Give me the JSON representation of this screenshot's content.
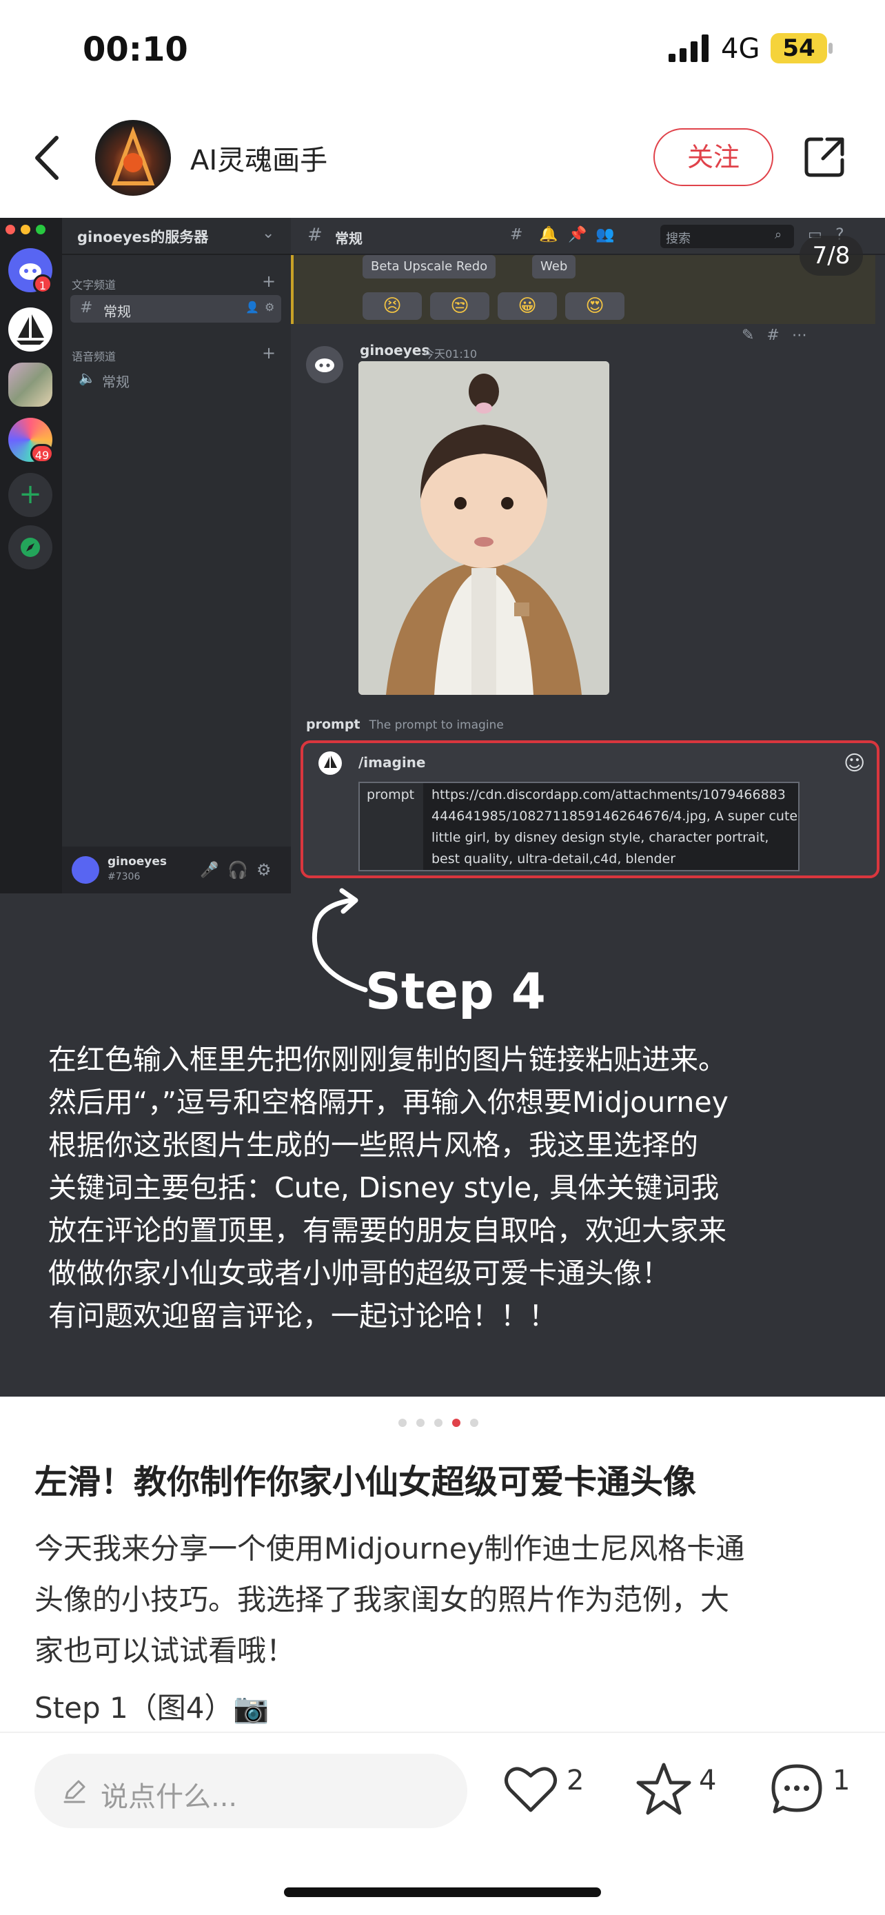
{
  "status_bar": {
    "time": "00:10",
    "network": "4G",
    "battery": "54"
  },
  "header": {
    "author": "AI灵魂画手",
    "follow_label": "关注"
  },
  "discord": {
    "server_name": "ginoeyes的服务器",
    "text_category": "文字频道",
    "text_channel": "常规",
    "voice_category": "语音频道",
    "voice_channel": "常规",
    "server_badge_1": "1",
    "server_badge_2": "49",
    "topbar_channel": "常规",
    "search_placeholder": "搜索",
    "button_upscale": "Beta Upscale Redo",
    "button_web": "Web",
    "reactions": [
      "😣",
      "😒",
      "😀",
      "😍"
    ],
    "message_author": "ginoeyes",
    "message_time": "今天01:10",
    "prompt_label": "prompt",
    "prompt_hint": "The prompt to imagine",
    "command": "/imagine",
    "prompt_field_label": "prompt",
    "prompt_lines": [
      "https://cdn.discordapp.com/attachments/1079466883",
      "444641985/1082711859146264676/4.jpg, A super cute",
      "little girl, by disney design style, character portrait,",
      "best quality, ultra-detail,c4d, blender"
    ],
    "user_name": "ginoeyes",
    "user_tag": "#7306"
  },
  "image_counter": "7/8",
  "step_label": "Step 4",
  "caption_lines": [
    "在红色输入框里先把你刚刚复制的图片链接粘贴进来。",
    "然后用“，”逗号和空格隔开，再输入你想要Midjourney",
    "根据你这张图片生成的一些照片风格，我这里选择的",
    "关键词主要包括：Cute, Disney style, 具体关键词我",
    "放在评论的置顶里，有需要的朋友自取哈，欢迎大家来",
    "做做你家小仙女或者小帅哥的超级可爱卡通头像！",
    "有问题欢迎留言评论，一起讨论哈！！！"
  ],
  "carousel": {
    "current": 4,
    "total": 5,
    "active_color": "#e0424a"
  },
  "post": {
    "title": "左滑！教你制作你家小仙女超级可爱卡通头像",
    "body_lines": [
      "今天我来分享一个使用Midjourney制作迪士尼风格卡通",
      "头像的小技巧。我选择了我家闺女的照片作为范例，大",
      "家也可以试试看哦！"
    ],
    "step1": "Step 1（图4）📷"
  },
  "bottom_bar": {
    "comment_placeholder": "说点什么...",
    "likes": "2",
    "favorites": "4",
    "comments": "1"
  },
  "colors": {
    "accent": "#e0424a",
    "discord_dark": "#313338",
    "prompt_border": "#d9363e"
  }
}
